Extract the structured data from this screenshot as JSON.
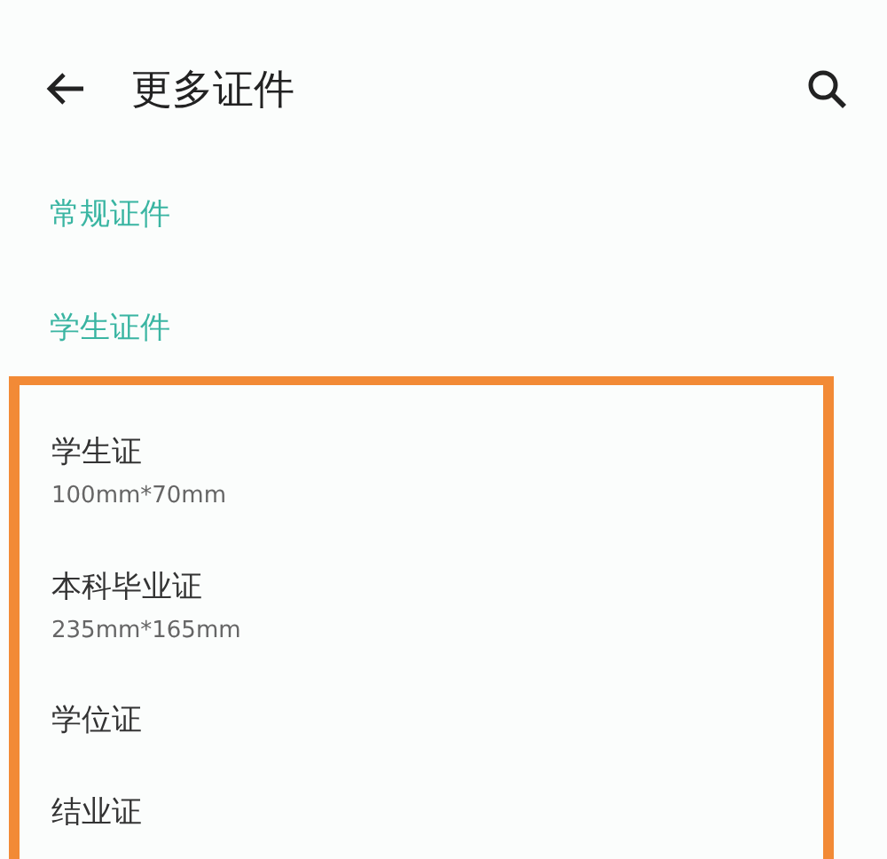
{
  "header": {
    "title": "更多证件"
  },
  "sections": [
    {
      "label": "常规证件"
    },
    {
      "label": "学生证件"
    }
  ],
  "items": [
    {
      "name": "学生证",
      "size": "100mm*70mm"
    },
    {
      "name": "本科毕业证",
      "size": "235mm*165mm"
    },
    {
      "name": "学位证"
    },
    {
      "name": "结业证"
    }
  ]
}
